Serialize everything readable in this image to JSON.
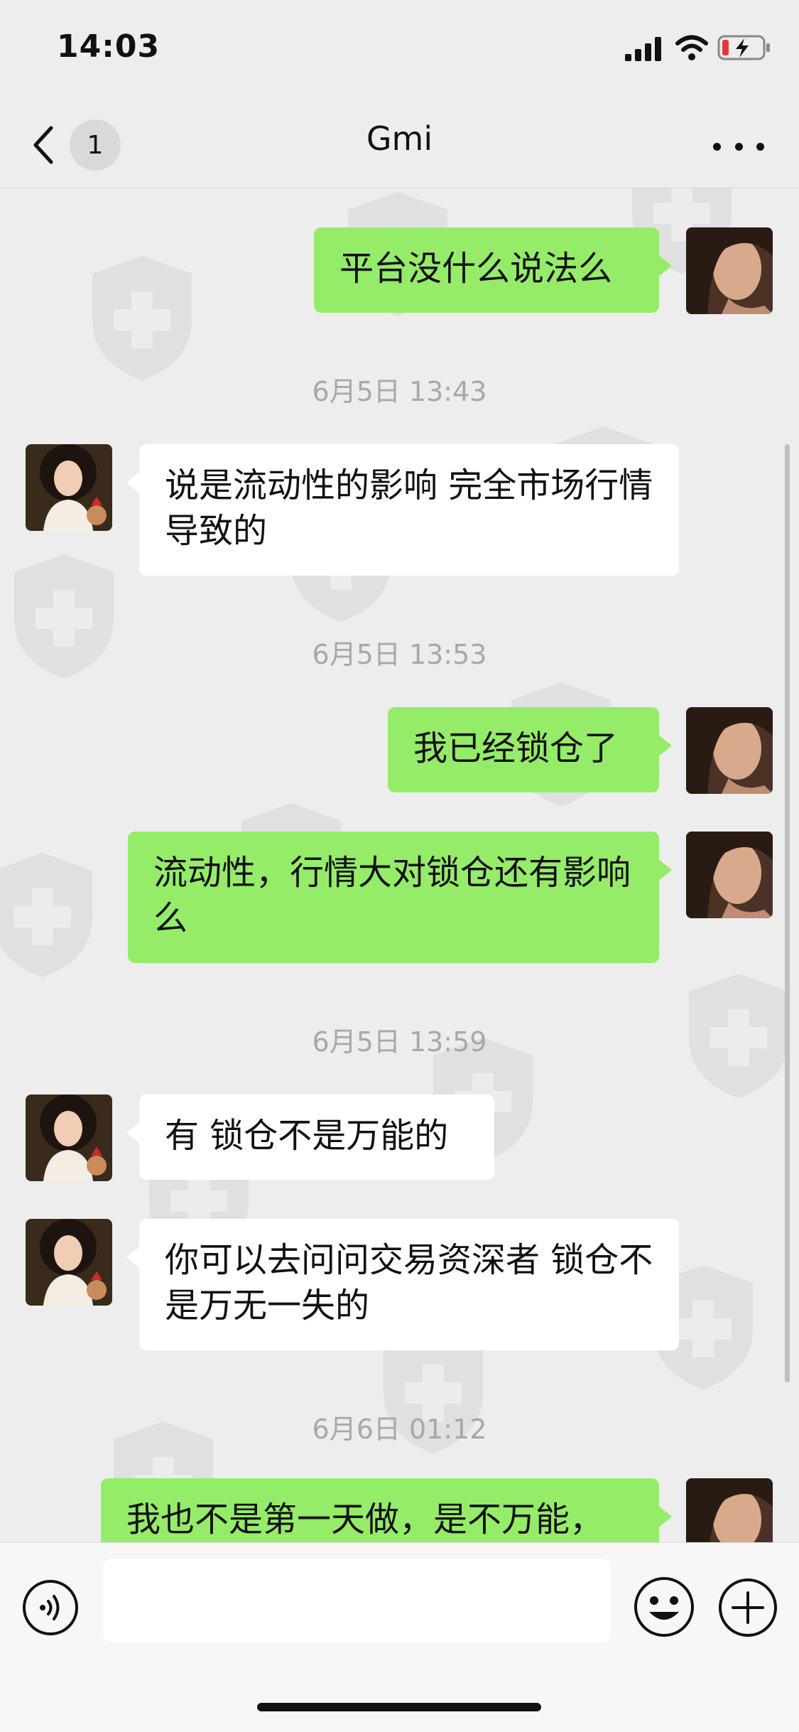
{
  "status_bar": {
    "time": "14:03"
  },
  "nav": {
    "unread_count": "1",
    "title": "Gmi"
  },
  "messages": [
    {
      "type": "sent",
      "text": "平台没什么说法么"
    },
    {
      "type": "time",
      "text": "6月5日 13:43"
    },
    {
      "type": "received",
      "text": "说是流动性的影响 完全市场行情导致的"
    },
    {
      "type": "time",
      "text": "6月5日 13:53"
    },
    {
      "type": "sent",
      "text": "我已经锁仓了"
    },
    {
      "type": "sent",
      "text": "流动性，行情大对锁仓还有影响么"
    },
    {
      "type": "time",
      "text": "6月5日 13:59"
    },
    {
      "type": "received",
      "text": "有 锁仓不是万能的"
    },
    {
      "type": "received",
      "text": "你可以去问问交易资深者 锁仓不是万无一失的"
    },
    {
      "type": "time",
      "text": "6月6日 01:12"
    },
    {
      "type": "sent",
      "text": "我也不是第一天做，是不万能，"
    }
  ],
  "input": {
    "value": ""
  },
  "colors": {
    "sent_bubble": "#95ec69",
    "received_bubble": "#ffffff",
    "background": "#ededed"
  }
}
